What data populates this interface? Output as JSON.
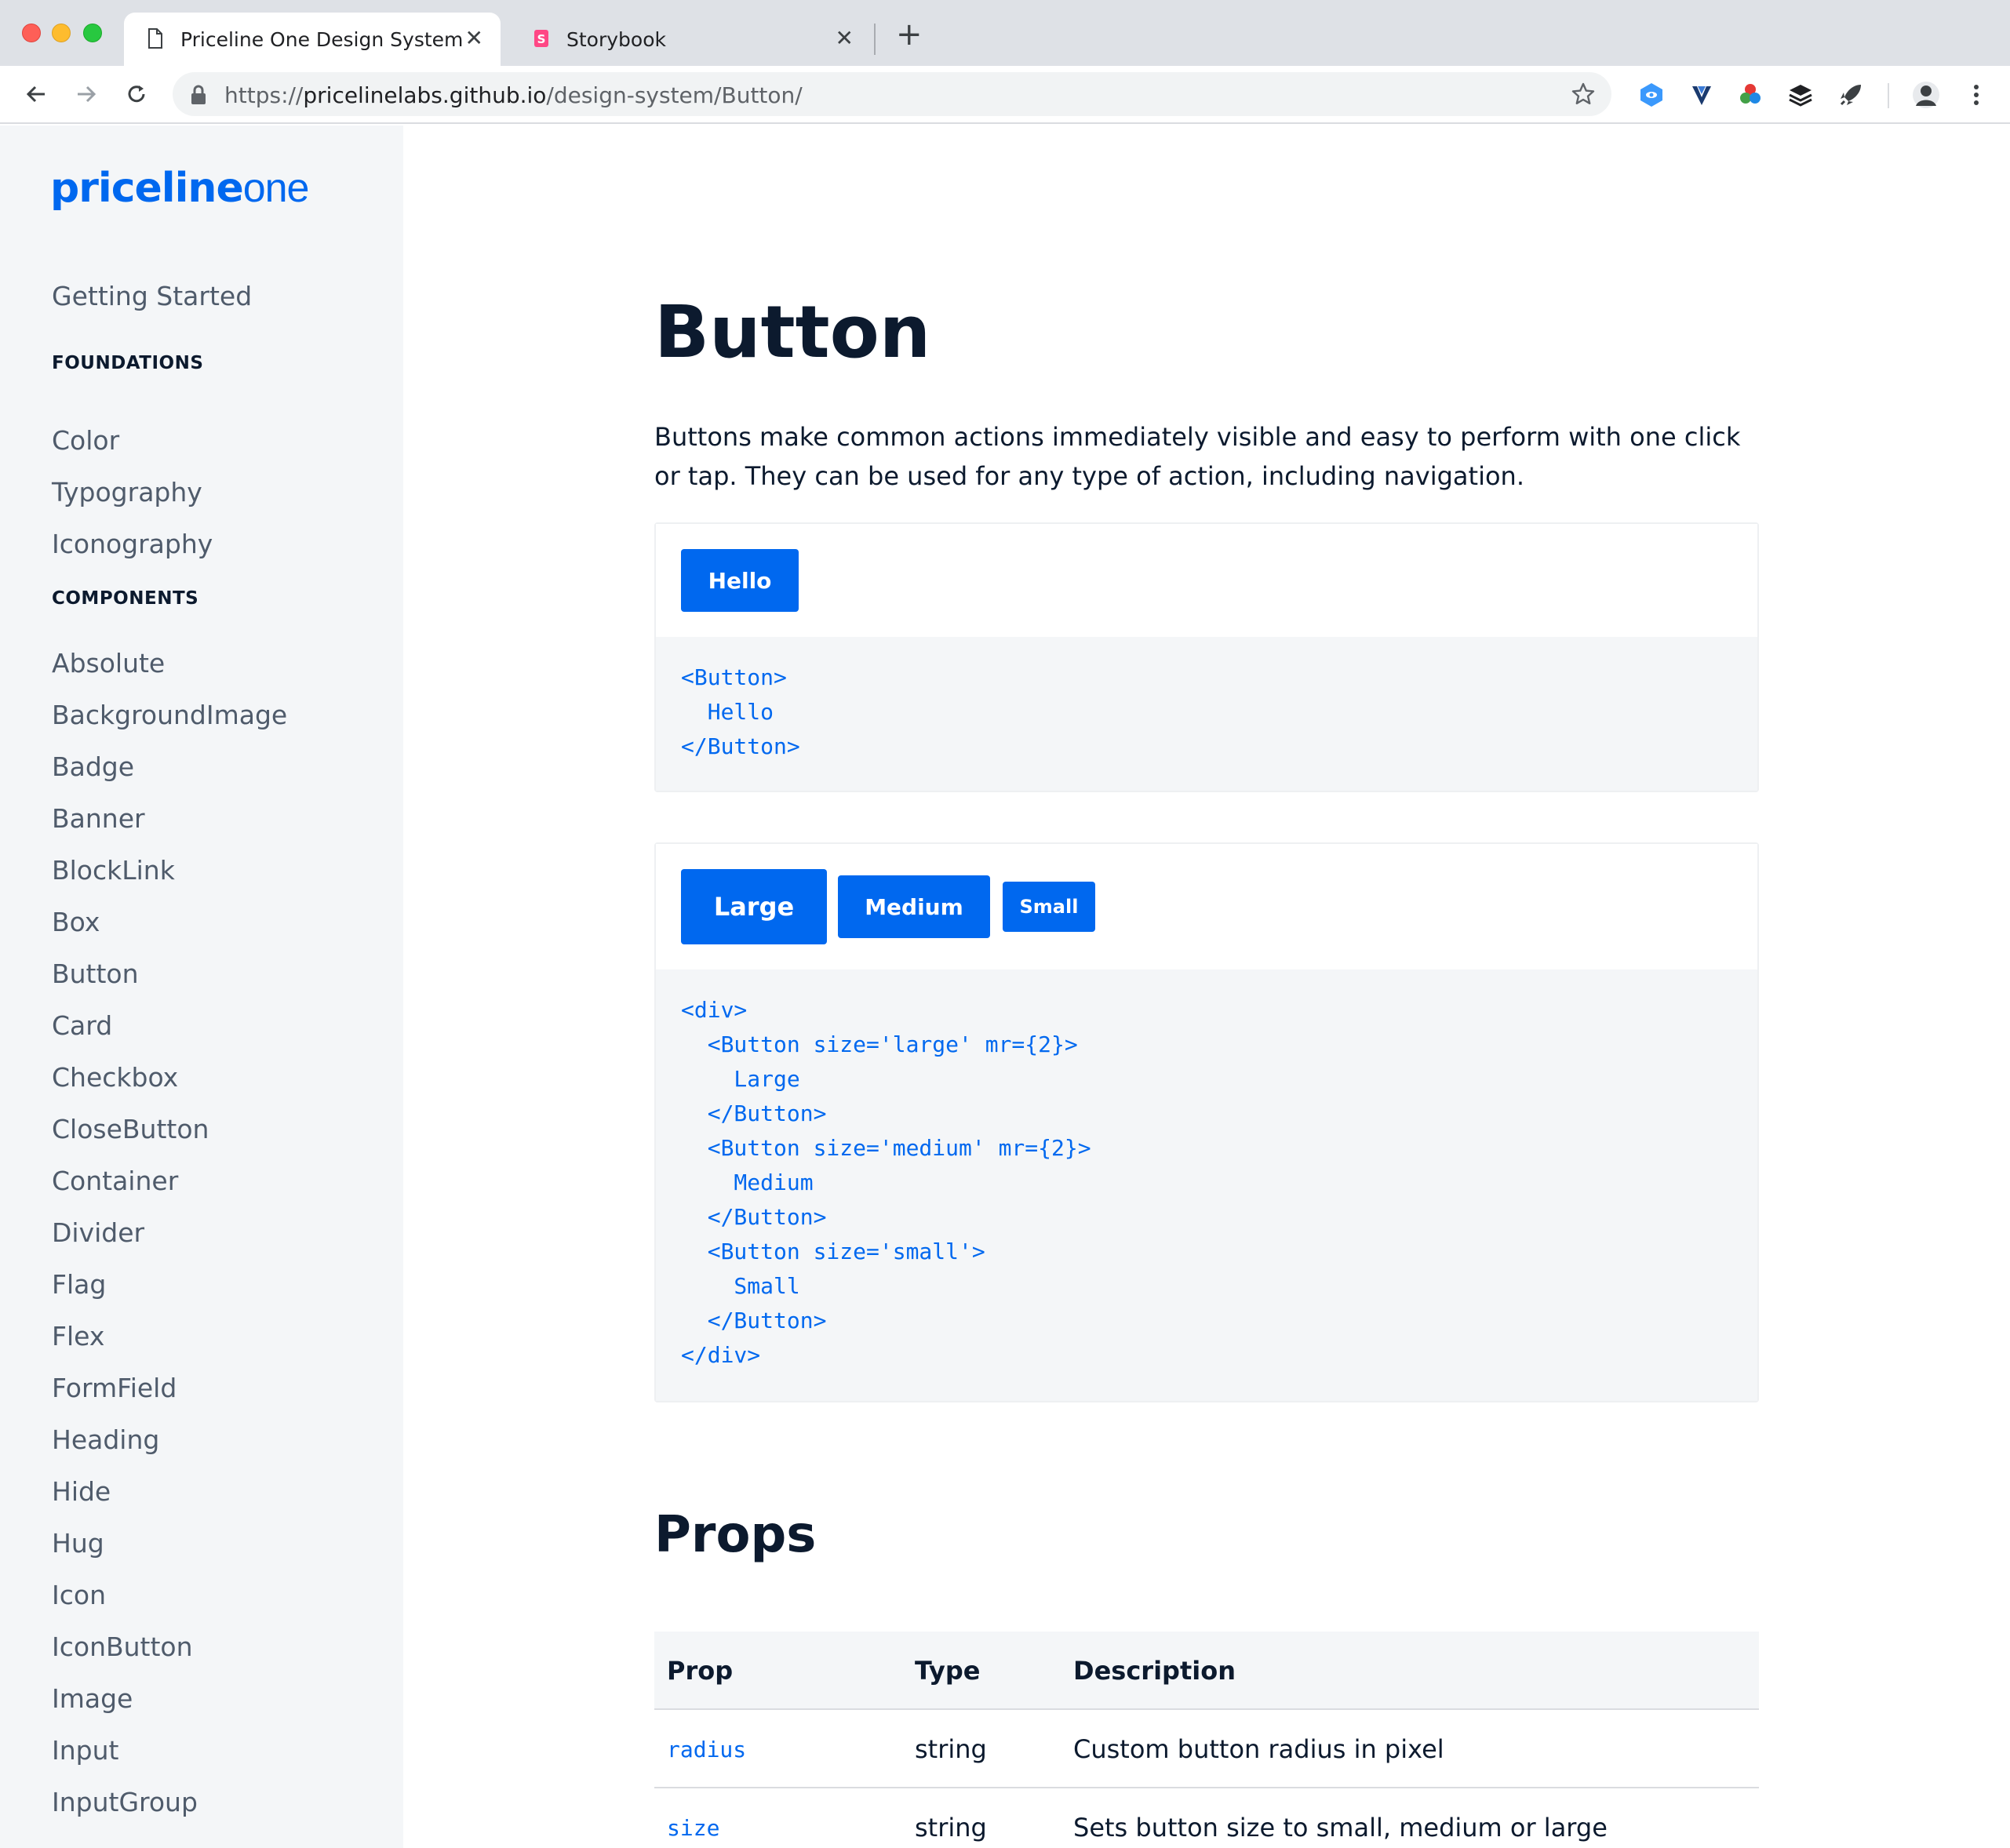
{
  "browser": {
    "tabs": [
      {
        "title": "Priceline One Design System",
        "active": true
      },
      {
        "title": "Storybook",
        "active": false
      }
    ],
    "url_scheme": "https://",
    "url_host": "pricelinelabs.github.io",
    "url_path": "/design-system/Button/",
    "new_tab_glyph": "+",
    "close_glyph": "✕"
  },
  "sidebar": {
    "logo_bold": "priceline",
    "logo_light": "one",
    "getting_started": "Getting Started",
    "foundations_heading": "FOUNDATIONS",
    "foundations": [
      "Color",
      "Typography",
      "Iconography"
    ],
    "components_heading": "COMPONENTS",
    "components": [
      "Absolute",
      "BackgroundImage",
      "Badge",
      "Banner",
      "BlockLink",
      "Box",
      "Button",
      "Card",
      "Checkbox",
      "CloseButton",
      "Container",
      "Divider",
      "Flag",
      "Flex",
      "FormField",
      "Heading",
      "Hide",
      "Hug",
      "Icon",
      "IconButton",
      "Image",
      "Input",
      "InputGroup"
    ]
  },
  "main": {
    "title": "Button",
    "lead": "Buttons make common actions immediately visible and easy to perform with one click or tap. They can be used for any type of action, including navigation.",
    "example1": {
      "button_label": "Hello",
      "code": "<Button>\n  Hello\n</Button>"
    },
    "example2": {
      "large_label": "Large",
      "medium_label": "Medium",
      "small_label": "Small",
      "code": "<div>\n  <Button size='large' mr={2}>\n    Large\n  </Button>\n  <Button size='medium' mr={2}>\n    Medium\n  </Button>\n  <Button size='small'>\n    Small\n  </Button>\n</div>"
    },
    "props_title": "Props",
    "props_table": {
      "headers": [
        "Prop",
        "Type",
        "Description"
      ],
      "rows": [
        [
          "radius",
          "string",
          "Custom button radius in pixel"
        ],
        [
          "size",
          "string",
          "Sets button size to small, medium or large"
        ]
      ]
    }
  },
  "colors": {
    "brand_blue": "#0068ef",
    "text_dark": "#0c1a2e",
    "sidebar_bg": "#f4f6f8"
  },
  "icons": [
    "document-icon",
    "storybook-icon",
    "back-arrow-icon",
    "forward-arrow-icon",
    "reload-icon",
    "lock-icon",
    "star-icon",
    "extension-icons",
    "profile-avatar",
    "menu-dots-icon"
  ]
}
